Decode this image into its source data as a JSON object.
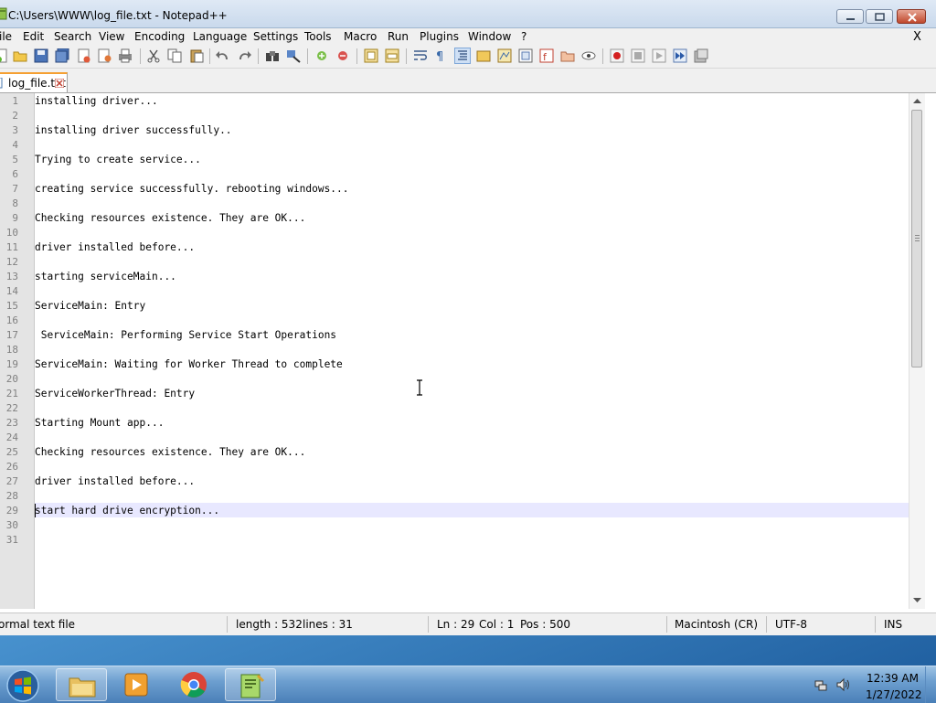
{
  "window": {
    "title": "C:\\Users\\WWW\\log_file.txt - Notepad++"
  },
  "menu": {
    "items": [
      "ile",
      "Edit",
      "Search",
      "View",
      "Encoding",
      "Language",
      "Settings",
      "Tools",
      "Macro",
      "Run",
      "Plugins",
      "Window",
      "?"
    ],
    "close_label": "X"
  },
  "tabs": [
    {
      "label": "log_file.txt",
      "active": true
    }
  ],
  "editor": {
    "current_line": 29,
    "lines": [
      "installing driver...",
      "",
      "installing driver successfully..",
      "",
      "Trying to create service...",
      "",
      "creating service successfully. rebooting windows...",
      "",
      "Checking resources existence. They are OK...",
      "",
      "driver installed before...",
      "",
      "starting serviceMain...",
      "",
      "ServiceMain: Entry",
      "",
      " ServiceMain: Performing Service Start Operations",
      "",
      "ServiceMain: Waiting for Worker Thread to complete",
      "",
      "ServiceWorkerThread: Entry",
      "",
      "Starting Mount app...",
      "",
      "Checking resources existence. They are OK...",
      "",
      "driver installed before...",
      "",
      "start hard drive encryption...",
      "",
      ""
    ],
    "line_numbers": [
      "1",
      "2",
      "3",
      "4",
      "5",
      "6",
      "7",
      "8",
      "9",
      "10",
      "11",
      "12",
      "13",
      "14",
      "15",
      "16",
      "17",
      "18",
      "19",
      "20",
      "21",
      "22",
      "23",
      "24",
      "25",
      "26",
      "27",
      "28",
      "29",
      "30",
      "31"
    ]
  },
  "statusbar": {
    "file_type": "ormal text file",
    "length": "length : 532",
    "lines": "lines : 31",
    "ln": "Ln : 29",
    "col": "Col : 1",
    "pos": "Pos : 500",
    "eol": "Macintosh (CR)",
    "encoding": "UTF-8",
    "mode": "INS"
  },
  "taskbar": {
    "time": "12:39 AM",
    "date": "1/27/2022",
    "pinned": [
      "explorer-icon",
      "media-player-icon",
      "chrome-icon",
      "notepadpp-icon"
    ]
  },
  "colors": {
    "current_line_bg": "#e8e8ff",
    "tab_accent": "#f5a032",
    "gutter_bg": "#e4e4e4"
  }
}
